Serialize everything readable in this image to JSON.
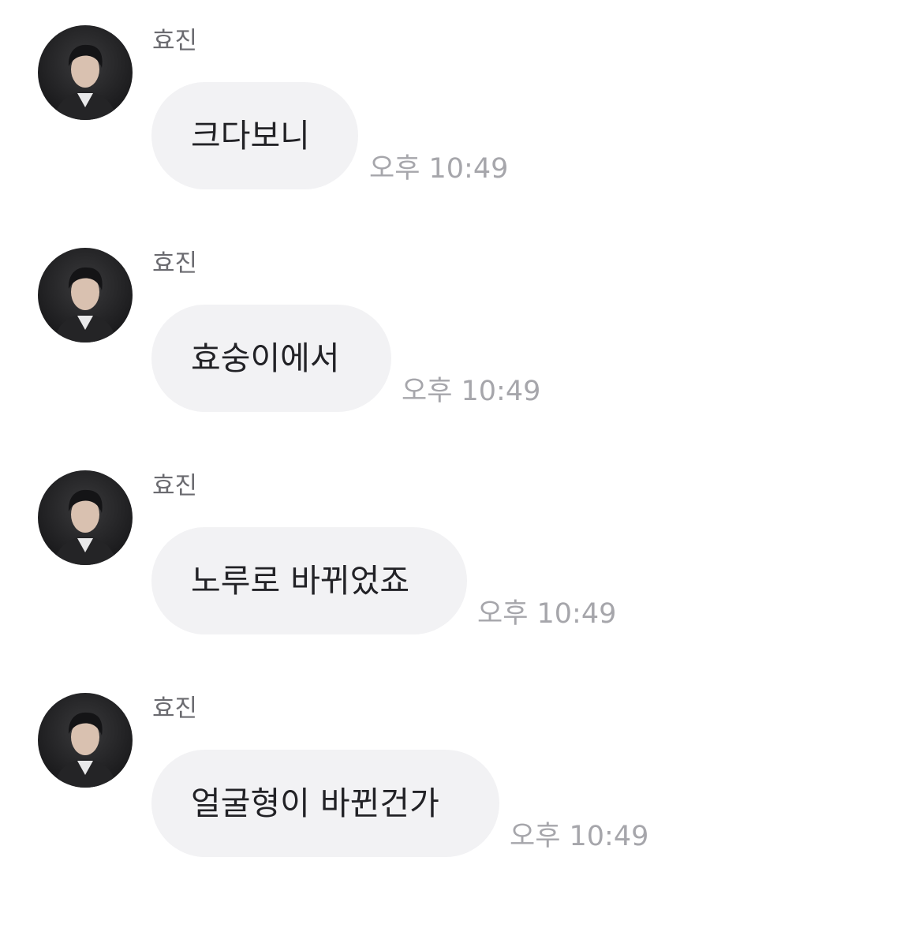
{
  "messages": [
    {
      "sender": "효진",
      "text": "크다보니",
      "time": "오후 10:49"
    },
    {
      "sender": "효진",
      "text": "효숭이에서",
      "time": "오후 10:49"
    },
    {
      "sender": "효진",
      "text": "노루로 바뀌었죠",
      "time": "오후 10:49"
    },
    {
      "sender": "효진",
      "text": "얼굴형이 바뀐건가",
      "time": "오후 10:49"
    }
  ]
}
